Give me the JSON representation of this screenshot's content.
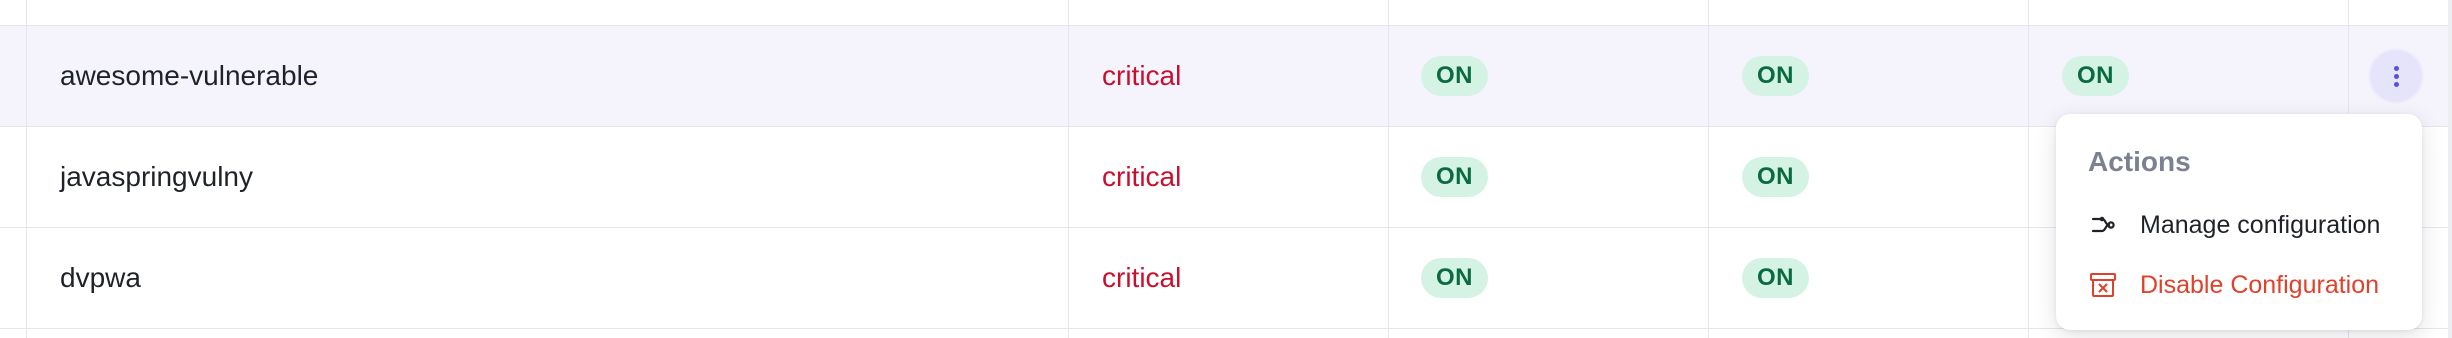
{
  "rows": [
    {
      "name": "awesome-vulnerable",
      "severity": "critical",
      "toggles": [
        "ON",
        "ON",
        "ON"
      ],
      "highlighted": true
    },
    {
      "name": "javaspringvulny",
      "severity": "critical",
      "toggles": [
        "ON",
        "ON"
      ]
    },
    {
      "name": "dvpwa",
      "severity": "critical",
      "toggles": [
        "ON",
        "ON"
      ]
    }
  ],
  "menu": {
    "title": "Actions",
    "items": [
      {
        "label": "Manage configuration",
        "icon": "settings-branch-icon"
      },
      {
        "label": "Disable Configuration",
        "icon": "archive-x-icon"
      }
    ]
  },
  "colors": {
    "row_highlight": "#f5f4fd",
    "severity_critical": "#c8102e",
    "pill_bg": "#d4f3e5",
    "pill_text": "#0b6b3f",
    "danger": "#e0412b",
    "accent": "#5b4fd8"
  }
}
